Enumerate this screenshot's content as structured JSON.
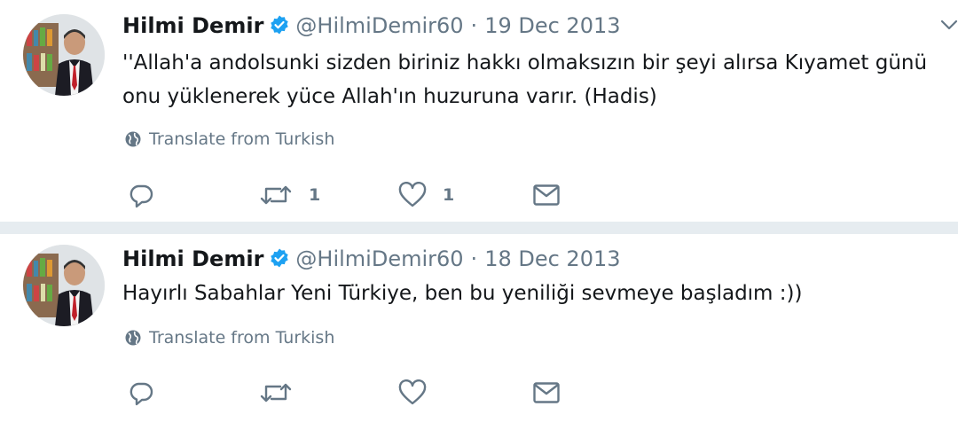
{
  "tweets": [
    {
      "name": "Hilmi Demir",
      "handle": "@HilmiDemir60",
      "separator": "·",
      "date": "19 Dec 2013",
      "text": "''Allah'a andolsunki sizden biriniz hakkı olmaksızın bir şeyi alırsa Kıyamet günü onu yüklenerek yüce Allah'ın huzuruna varır. (Hadis)",
      "translate": "Translate from Turkish",
      "retweet_count": "1",
      "like_count": "1"
    },
    {
      "name": "Hilmi Demir",
      "handle": "@HilmiDemir60",
      "separator": "·",
      "date": "18 Dec 2013",
      "text": "Hayırlı Sabahlar Yeni Türkiye, ben bu yeniliği sevmeye başladım :))",
      "translate": "Translate from Turkish",
      "retweet_count": "",
      "like_count": ""
    }
  ],
  "colors": {
    "verified": "#1da1f2",
    "secondary_text": "#657786",
    "divider": "#e6ecf0"
  },
  "icons": [
    "verified-badge-icon",
    "globe-icon",
    "reply-icon",
    "retweet-icon",
    "like-icon",
    "message-icon",
    "chevron-down-icon"
  ]
}
